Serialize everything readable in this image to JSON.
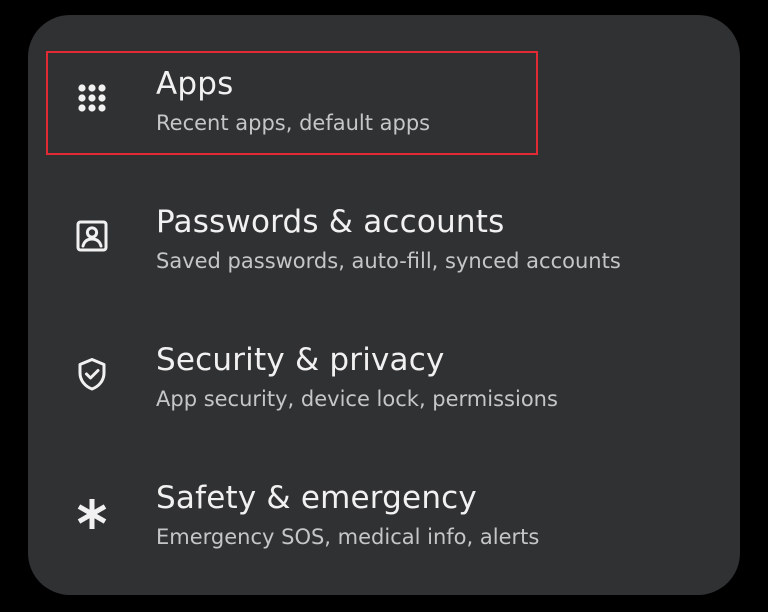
{
  "settings": {
    "items": [
      {
        "title": "Apps",
        "subtitle": "Recent apps, default apps",
        "icon": "apps-grid-icon",
        "highlighted": true
      },
      {
        "title": "Passwords & accounts",
        "subtitle": "Saved passwords, auto-fill, synced accounts",
        "icon": "account-box-icon",
        "highlighted": false
      },
      {
        "title": "Security & privacy",
        "subtitle": "App security, device lock, permissions",
        "icon": "shield-check-icon",
        "highlighted": false
      },
      {
        "title": "Safety & emergency",
        "subtitle": "Emergency SOS, medical info, alerts",
        "icon": "asterisk-icon",
        "highlighted": false
      }
    ]
  },
  "colors": {
    "background": "#000000",
    "panel": "#303133",
    "title_text": "#f1f1f1",
    "subtitle_text": "#c4c6c8",
    "highlight_border": "#e02b35"
  }
}
